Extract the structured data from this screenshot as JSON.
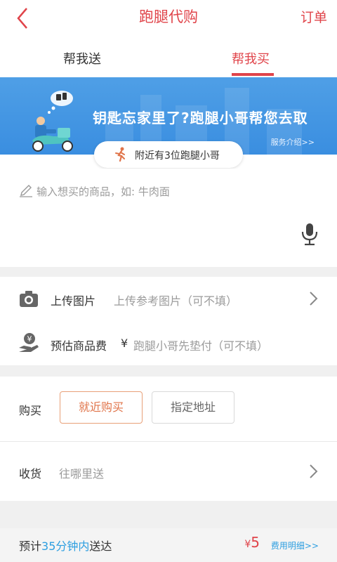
{
  "nav": {
    "title": "跑腿代购",
    "right_label": "订单"
  },
  "tabs": [
    {
      "label": "帮我送"
    },
    {
      "label": "帮我买"
    }
  ],
  "banner": {
    "slogan": "钥匙忘家里了?跑腿小哥帮您去取",
    "link": "服务介绍>>"
  },
  "nearby": {
    "text": "附近有3位跑腿小哥"
  },
  "goods_input": {
    "placeholder": "输入想买的商品，如: 牛肉面"
  },
  "upload": {
    "label": "上传图片",
    "hint": "上传参考图片（可不填）"
  },
  "fee": {
    "label": "预估商品费",
    "currency": "¥",
    "hint": "跑腿小哥先垫付（可不填）"
  },
  "purchase": {
    "label": "购买",
    "options": [
      "就近购买",
      "指定地址"
    ],
    "selected": "就近购买"
  },
  "receive": {
    "label": "收货",
    "placeholder": "往哪里送"
  },
  "footer": {
    "eta_prefix": "预计",
    "eta_time": "35分钟内",
    "eta_suffix": "送达",
    "price_currency": "¥",
    "price": "5",
    "detail_link": "费用明细>>"
  },
  "colors": {
    "accent": "#e0444a",
    "banner_blue": "#3a8ee0",
    "link_blue": "#2d9ee0",
    "orange": "#e0744a"
  }
}
